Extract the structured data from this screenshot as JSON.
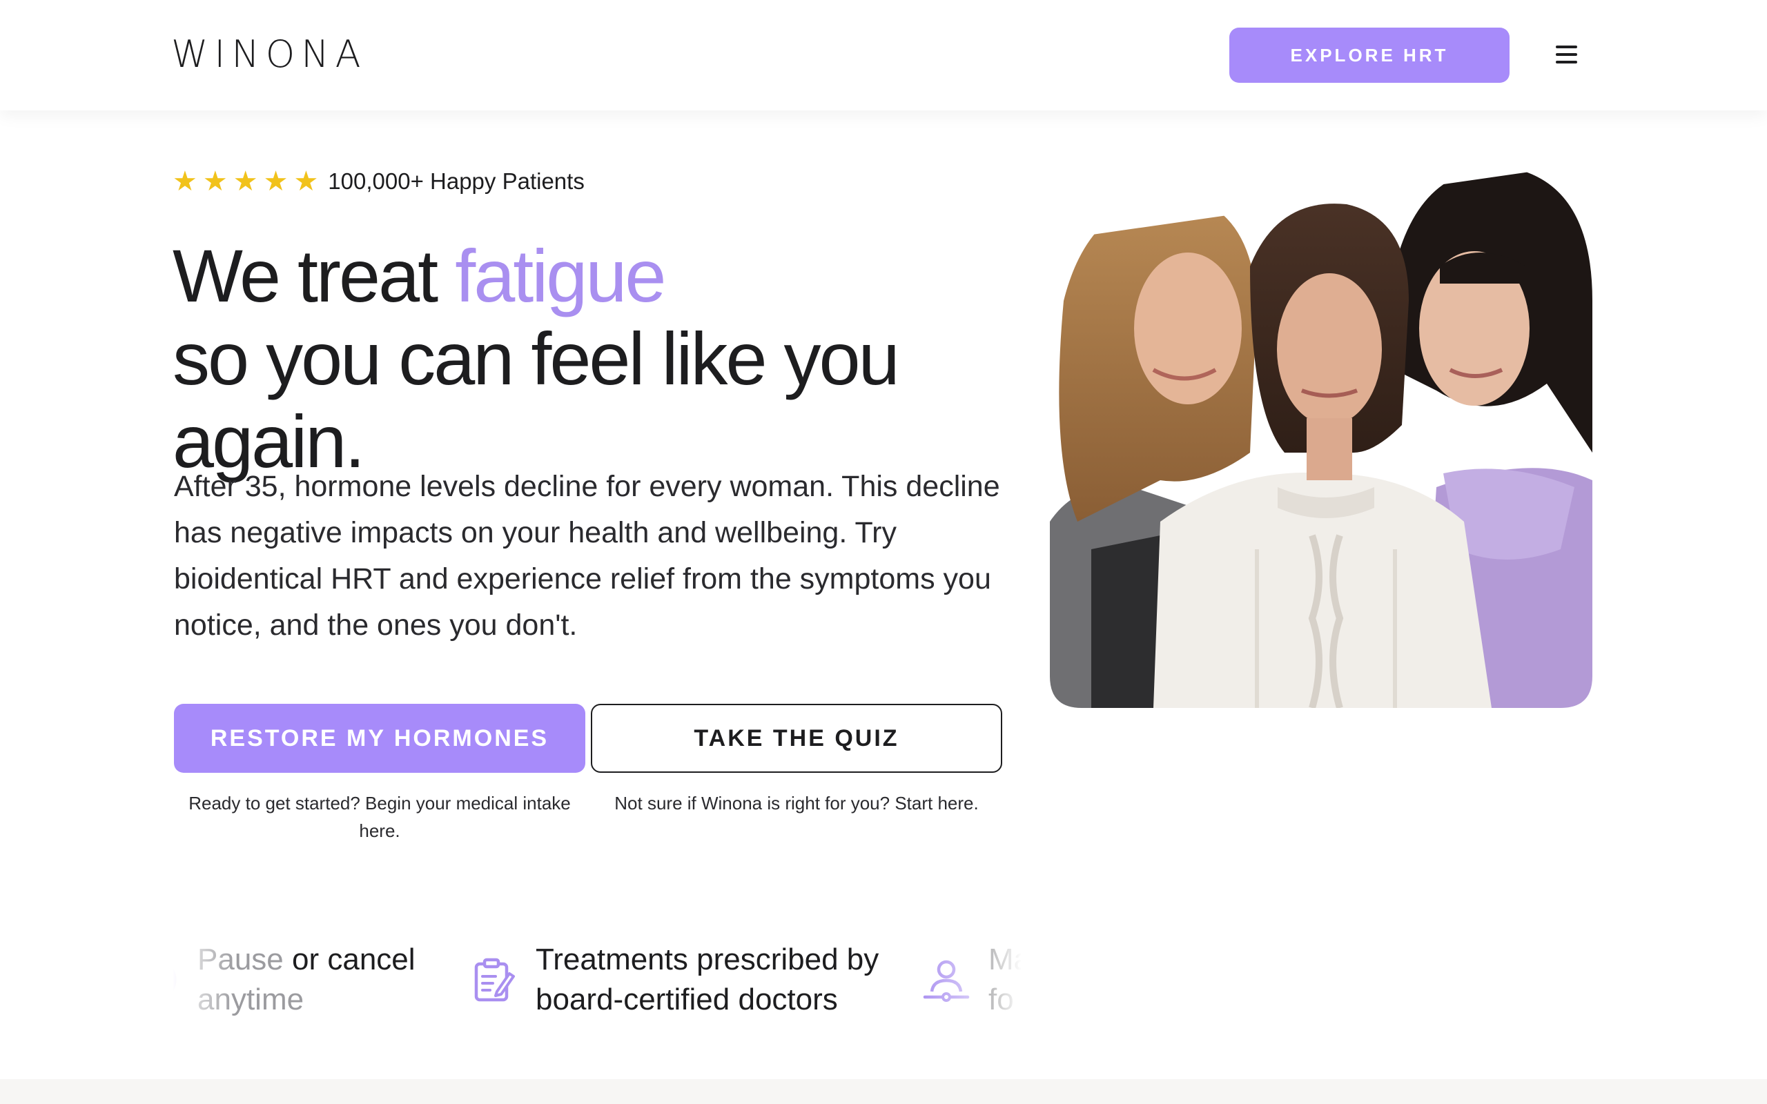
{
  "brand": {
    "logo_text": "WINONA",
    "accent_color": "#a98ff0",
    "button_color": "#a78bfa",
    "star_color": "#f1c21b"
  },
  "header": {
    "cta_label": "EXPLORE HRT",
    "menu_icon": "hamburger-menu-icon"
  },
  "hero": {
    "rating": {
      "stars": 5,
      "text": "100,000+ Happy Patients"
    },
    "headline": {
      "prefix": "We treat",
      "highlight": "fatigue",
      "line2": "so you can feel like you again."
    },
    "body": "After 35, hormone levels decline for every woman. This decline has negative impacts on your health and wellbeing. Try bioidentical HRT and experience relief from the symptoms you notice, and the ones you don't.",
    "primary_cta": {
      "label": "RESTORE MY HORMONES",
      "caption": "Ready to get started? Begin your medical intake here."
    },
    "secondary_cta": {
      "label": "TAKE THE QUIZ",
      "caption": "Not sure if Winona is right for you? Start here."
    },
    "image": "photo-three-smiling-women"
  },
  "features": [
    {
      "icon": "cancel-icon",
      "text_part1": "Pause",
      "text_part2": "or cancel",
      "line2": "anytime"
    },
    {
      "icon": "clipboard-icon",
      "line1": "Treatments prescribed by",
      "line2": "board-certified doctors"
    },
    {
      "icon": "user-icon",
      "line1": "Ma",
      "line2": "fo"
    }
  ]
}
